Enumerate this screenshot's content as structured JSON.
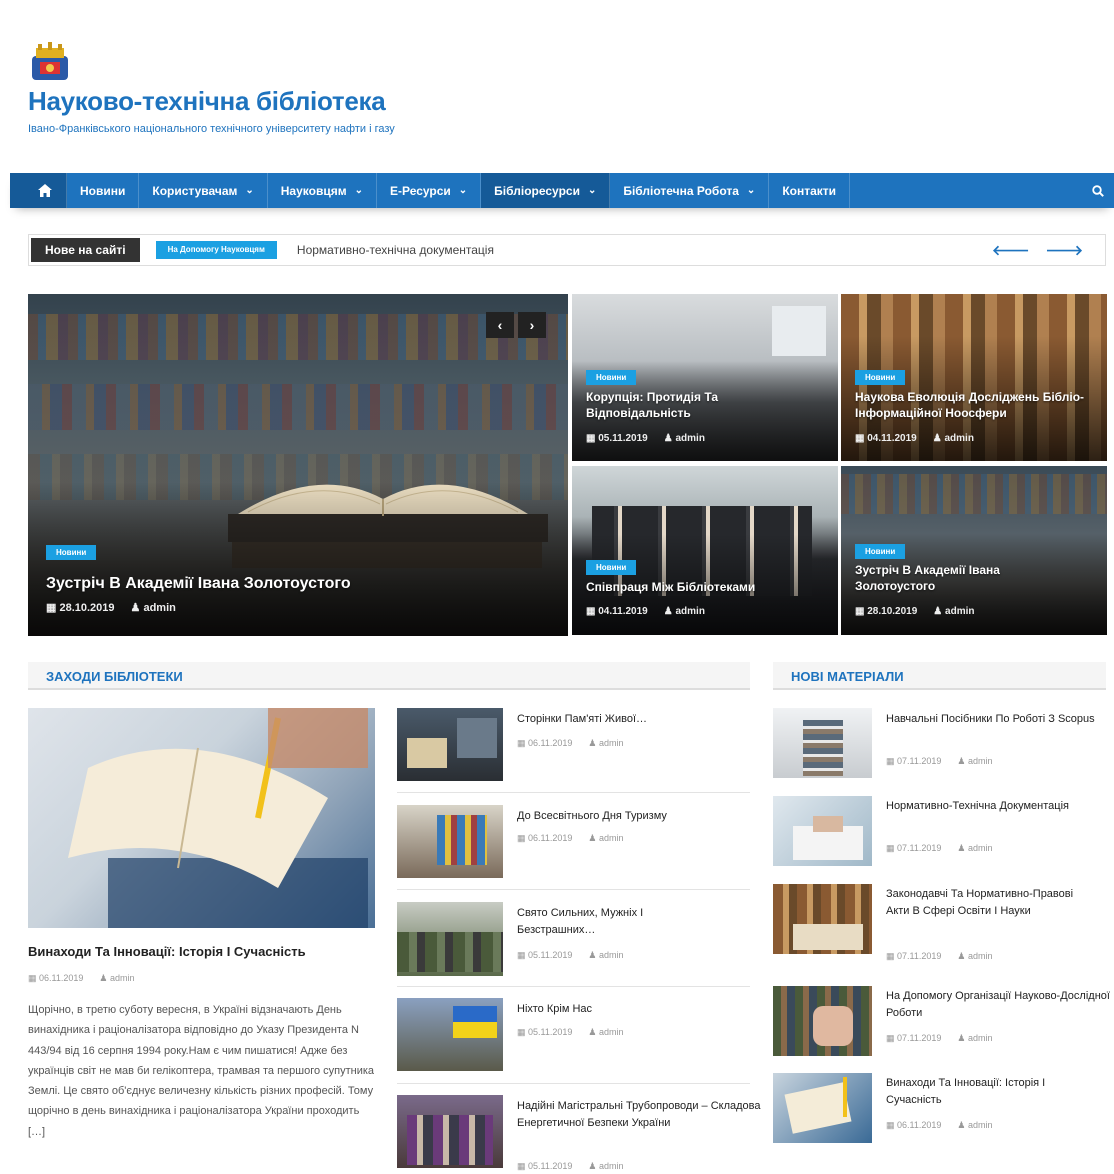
{
  "site": {
    "title": "Науково-технічна бібліотека",
    "description": "Івано-Франківського національного технічного університету нафти і газу"
  },
  "nav": {
    "items": [
      {
        "label": "Новини"
      },
      {
        "label": "Користувачам"
      },
      {
        "label": "Науковцям"
      },
      {
        "label": "Е-Ресурси"
      },
      {
        "label": "Бібліоресурси"
      },
      {
        "label": "Бібліотечна Робота"
      },
      {
        "label": "Контакти"
      }
    ],
    "active": "Бібліоресурси",
    "caret": "⌄",
    "home_icon": "home-icon",
    "search_icon": "search-icon"
  },
  "ticker": {
    "label": "Нове на сайті",
    "category": "На Допомогу Науковцям",
    "text": "Нормативно-технічна документація",
    "arrows": "🡐 🡒"
  },
  "slider": {
    "category": "Новини",
    "title": "Зустріч В Академії Івана Золотоустого",
    "date": "28.10.2019",
    "author": "admin",
    "prev": "‹",
    "next": "›"
  },
  "tiles": [
    {
      "category": "Новини",
      "title": "Корупція: Протидія Та Відповідальність",
      "date": "05.11.2019",
      "author": "admin"
    },
    {
      "category": "Новини",
      "title": "Наукова Еволюція Досліджень Бібліо-Інформаційної Ноосфери",
      "date": "04.11.2019",
      "author": "admin"
    },
    {
      "category": "Новини",
      "title": "Співпраця Між Бібліотеками",
      "date": "04.11.2019",
      "author": "admin"
    },
    {
      "category": "Новини",
      "title": "Зустріч В Академії Івана Золотоустого",
      "date": "28.10.2019",
      "author": "admin"
    }
  ],
  "events": {
    "heading": "ЗАХОДИ БІБЛІОТЕКИ",
    "featured": {
      "title": "Винаходи Та Інновації: Історія І Сучасність",
      "date": "06.11.2019",
      "author": "admin",
      "excerpt": "Щорічно, в третю суботу вересня, в Україні відзначають День винахідника і раціоналізатора відповідно до Указу Президента N 443/94 від 16 серпня 1994 року.Нам є чим пишатися! Адже без українців світ не мав би гелікоптера, трамвая та першого супутника Землі. Це свято об'єднує величезну кількість різних професій. Тому щорічно в день винахідника і раціоналізатора України проходить […]"
    },
    "list": [
      {
        "title": "Сторінки Пам'яті Живої…",
        "date": "06.11.2019",
        "author": "admin"
      },
      {
        "title": "До Всесвітнього Дня Туризму",
        "date": "06.11.2019",
        "author": "admin"
      },
      {
        "title": "Свято Сильних, Мужніх І Безстрашних…",
        "date": "05.11.2019",
        "author": "admin"
      },
      {
        "title": "Ніхто Крім Нас",
        "date": "05.11.2019",
        "author": "admin"
      },
      {
        "title": "Надійні Магістральні Трубопроводи – Складова Енергетичної Безпеки України",
        "date": "05.11.2019",
        "author": "admin"
      }
    ]
  },
  "materials": {
    "heading": "НОВІ МАТЕРІАЛИ",
    "list": [
      {
        "title": "Навчальні Посібники По Роботі З Scopus",
        "date": "07.11.2019",
        "author": "admin"
      },
      {
        "title": "Нормативно-Технічна Документація",
        "date": "07.11.2019",
        "author": "admin"
      },
      {
        "title": "Законодавчі Та Нормативно-Правові Акти В Сфері Освіти І Науки",
        "date": "07.11.2019",
        "author": "admin"
      },
      {
        "title": "На Допомогу Організації Науково-Дослідної Роботи",
        "date": "07.11.2019",
        "author": "admin"
      },
      {
        "title": "Винаходи Та Інновації: Історія І Сучасність",
        "date": "06.11.2019",
        "author": "admin"
      }
    ]
  },
  "icons": {
    "calendar": "calendar-icon",
    "user": "user-icon"
  },
  "colors": {
    "primary": "#1e73be",
    "accent": "#1ba0e2",
    "dark": "#333333"
  }
}
